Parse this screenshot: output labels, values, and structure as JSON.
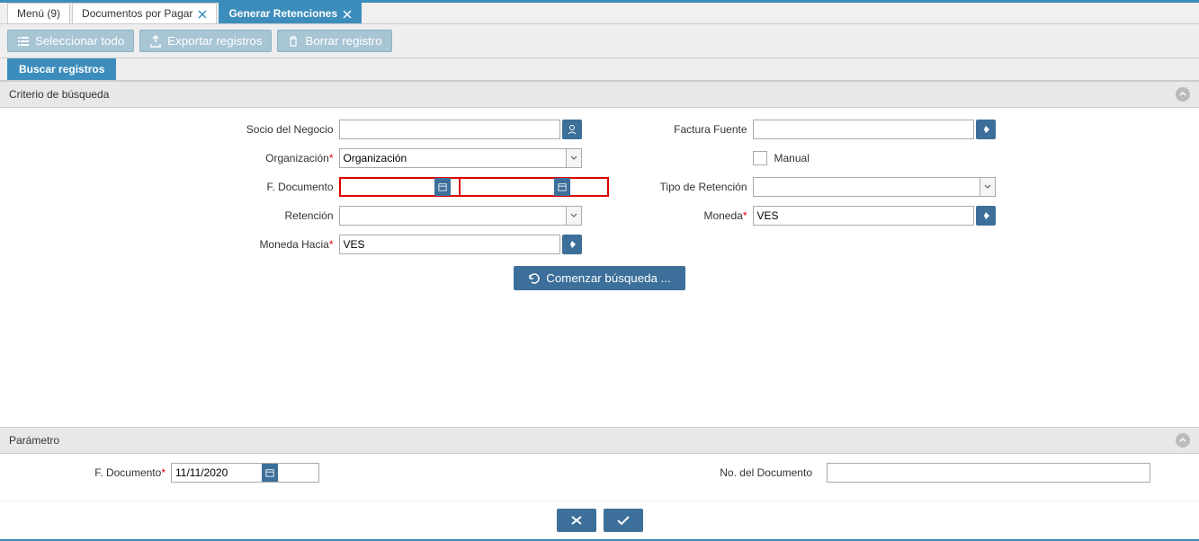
{
  "tabs": [
    {
      "label": "Menú (9)"
    },
    {
      "label": "Documentos por Pagar"
    },
    {
      "label": "Generar Retenciones"
    }
  ],
  "toolbar": {
    "select_all": "Seleccionar todo",
    "export": "Exportar registros",
    "delete": "Borrar registro"
  },
  "subtab": {
    "search": "Buscar registros"
  },
  "criteria": {
    "header": "Criterio de búsqueda",
    "socio_label": "Socio del Negocio",
    "org_label": "Organización",
    "org_value": "Organización",
    "fdoc_label": "F. Documento",
    "retencion_label": "Retención",
    "moneda_hacia_label": "Moneda Hacia",
    "moneda_hacia_value": "VES",
    "factura_label": "Factura Fuente",
    "manual_label": "Manual",
    "tipo_ret_label": "Tipo de Retención",
    "moneda_label": "Moneda",
    "moneda_value": "VES",
    "search_btn": "Comenzar búsqueda ..."
  },
  "param": {
    "header": "Parámetro",
    "fdoc_label": "F. Documento",
    "fdoc_value": "11/11/2020",
    "nodoc_label": "No. del Documento"
  }
}
